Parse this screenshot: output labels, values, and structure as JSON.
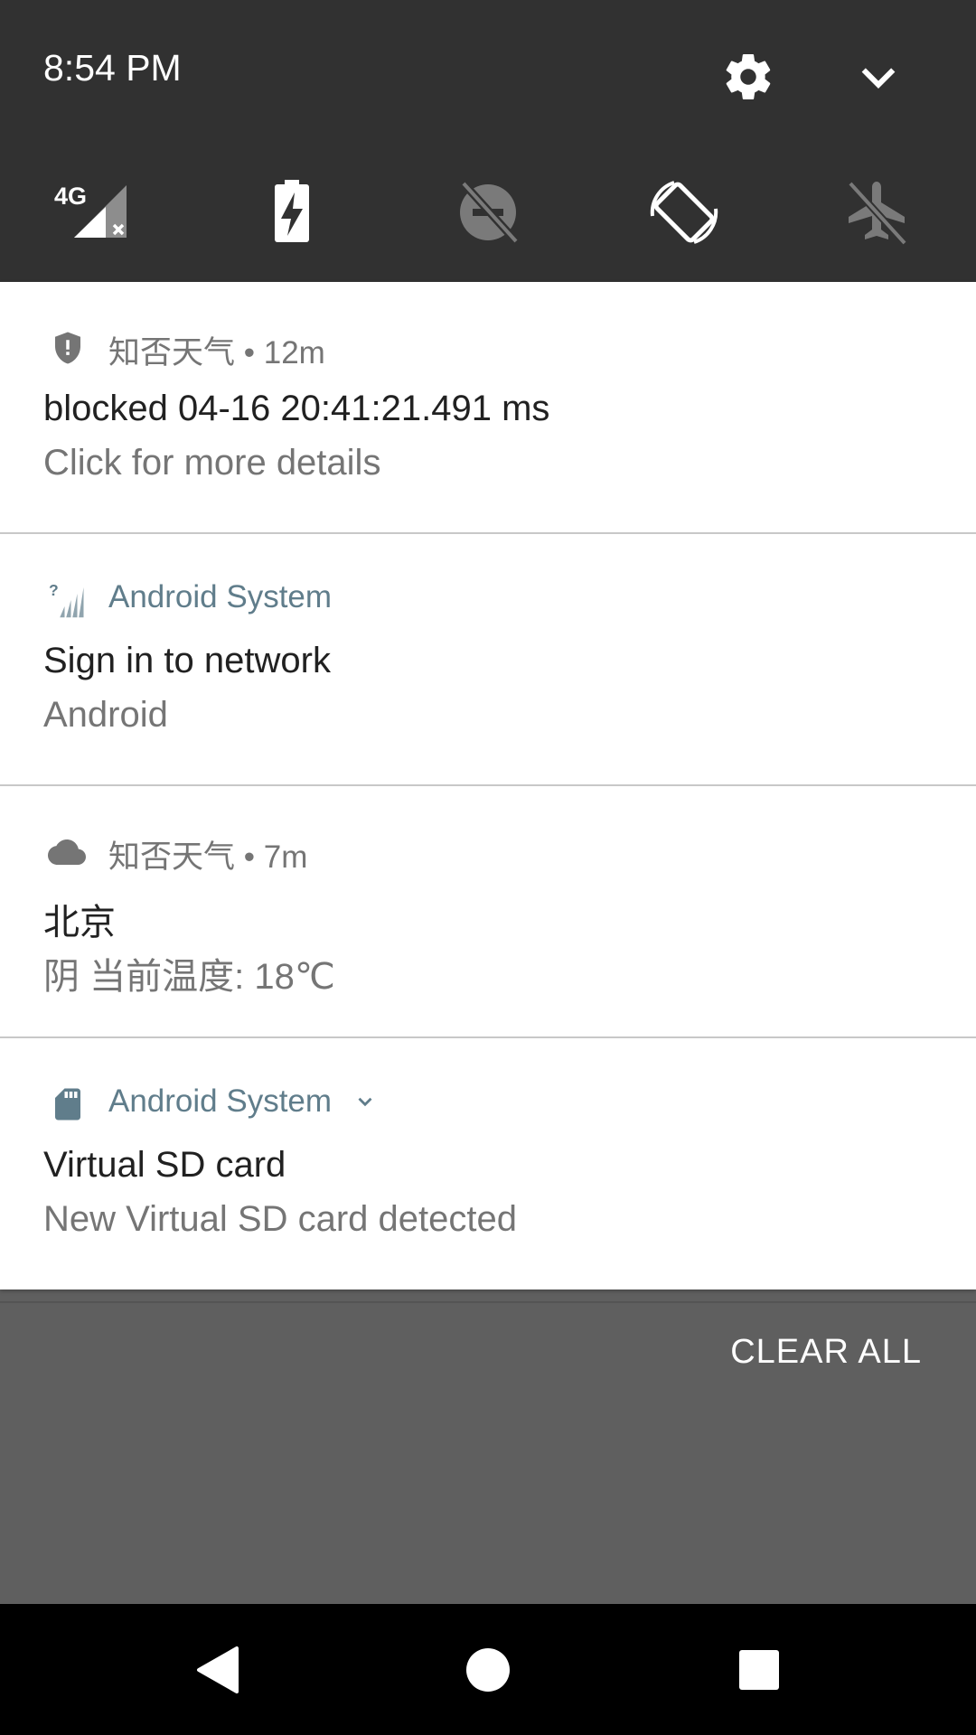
{
  "status": {
    "time": "8:54 PM"
  },
  "quick_settings": {
    "tiles": [
      {
        "icon": "signal-4g-no-data-icon",
        "label": "4G"
      },
      {
        "icon": "battery-saver-icon"
      },
      {
        "icon": "do-not-disturb-off-icon"
      },
      {
        "icon": "auto-rotate-icon"
      },
      {
        "icon": "airplane-mode-off-icon"
      }
    ]
  },
  "notifications": [
    {
      "app": "知否天气",
      "time": "• 12m",
      "icon": "shield-icon",
      "title": "blocked 04-16 20:41:21.491 ms",
      "text": "Click for more details"
    },
    {
      "app": "Android System",
      "time": "",
      "icon": "signal-unknown-icon",
      "title": "Sign in to network",
      "text": "Android"
    },
    {
      "app": "知否天气",
      "time": "• 7m",
      "icon": "cloud-icon",
      "title": "北京",
      "text": "阴 当前温度: 18℃"
    },
    {
      "app": "Android System",
      "time": "",
      "icon": "sd-card-icon",
      "title": "Virtual SD card",
      "text": "New Virtual SD card detected"
    }
  ],
  "actions": {
    "clear_all": "CLEAR ALL"
  },
  "colors": {
    "shade_bg": "#313131",
    "notification_bg": "#ffffff",
    "accent_system": "#607d8b",
    "backdrop": "#5f5f5f"
  }
}
